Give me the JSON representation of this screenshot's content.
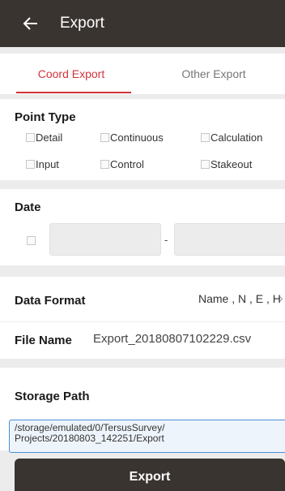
{
  "appbar": {
    "title": "Export"
  },
  "tabs": [
    {
      "label": "Coord Export",
      "active": true
    },
    {
      "label": "Other Export",
      "active": false
    }
  ],
  "point_type": {
    "title": "Point Type",
    "options": [
      "Detail",
      "Continuous",
      "Calculation",
      "Input",
      "Control",
      "Stakeout"
    ]
  },
  "date": {
    "title": "Date",
    "start": "",
    "end": "",
    "separator": "-"
  },
  "data_format": {
    "label": "Data Format",
    "value": "Name , N , E , H",
    "chevron": "›"
  },
  "file_name": {
    "label": "File Name",
    "value": "Export_20180807102229.csv"
  },
  "storage_path": {
    "label": "Storage Path",
    "lines": [
      "/storage/emulated/0/TersusSurvey/",
      "Projects/20180803_142251/Export"
    ]
  },
  "export_button": {
    "label": "Export"
  },
  "colors": {
    "appbar": "#3a3431",
    "accent": "#d0343b",
    "path_border": "#4a90d9"
  }
}
